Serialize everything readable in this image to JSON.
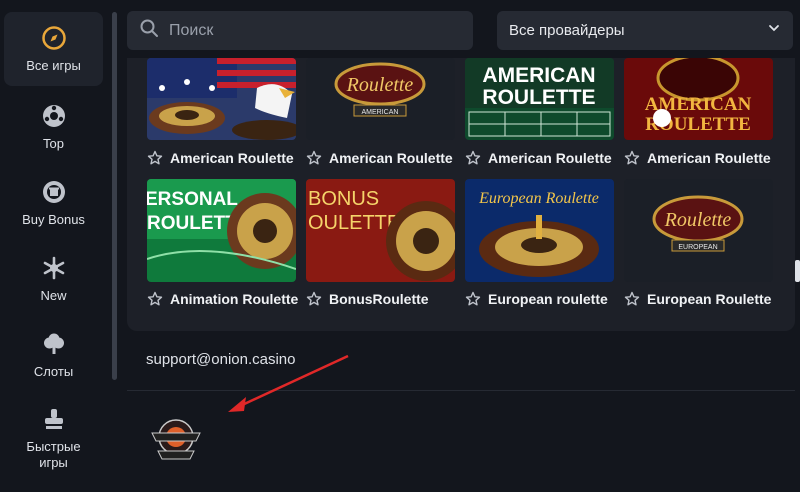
{
  "sidebar": {
    "items": [
      {
        "label": "Все игры",
        "icon": "compass-icon",
        "active": true
      },
      {
        "label": "Top",
        "icon": "ball-icon",
        "active": false
      },
      {
        "label": "Buy Bonus",
        "icon": "bonus-chip-icon",
        "active": false
      },
      {
        "label": "New",
        "icon": "burst-icon",
        "active": false
      },
      {
        "label": "Слоты",
        "icon": "clover-icon",
        "active": false
      },
      {
        "label": "Быстрые игры",
        "icon": "stamp-icon",
        "active": false
      }
    ]
  },
  "search": {
    "placeholder": "Поиск",
    "value": ""
  },
  "provider": {
    "label": "Все провайдеры"
  },
  "games": [
    {
      "title": "American Roulette",
      "art_text": ""
    },
    {
      "title": "American Roulette",
      "art_text": "Roulette",
      "sub": "AMERICAN"
    },
    {
      "title": "American Roulette",
      "art_text": "AMERICAN",
      "art_text2": "ROULETTE"
    },
    {
      "title": "American Roulette",
      "art_text": "AMERICAN",
      "art_text2": "ROULETTE"
    },
    {
      "title": "Animation Roulette",
      "art_text": "ERSONAL",
      "art_text2": "ROULETTE"
    },
    {
      "title": "BonusRoulette",
      "art_text": "BONUS",
      "art_text2": "OULETTE"
    },
    {
      "title": "European roulette",
      "art_text": "European Roulette"
    },
    {
      "title": "European Roulette",
      "art_text": "Roulette",
      "sub": "EUROPEAN"
    }
  ],
  "support_email": "support@onion.casino",
  "colors": {
    "accent": "#e9a73a",
    "bg": "#13161d",
    "panel": "#1d2028",
    "arrow": "#e02828"
  }
}
